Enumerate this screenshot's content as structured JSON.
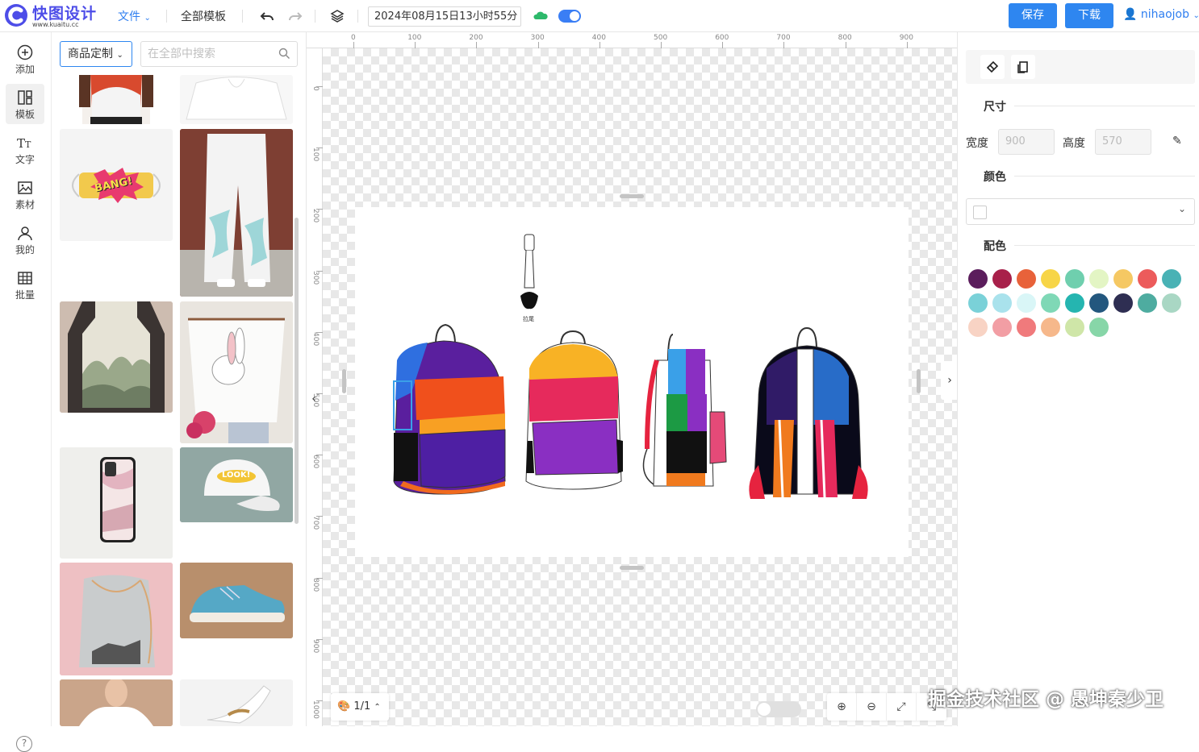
{
  "app": {
    "logo_name": "快图设计",
    "logo_url": "www.kuaitu.cc"
  },
  "toolbar": {
    "file_menu": "文件",
    "all_templates": "全部模板",
    "timestamp": "2024年08月15日13小时55分",
    "save_label": "保存",
    "download_label": "下载",
    "username": "nihaojob",
    "icons": [
      "undo-icon",
      "redo-icon",
      "layers-icon",
      "cloud-icon"
    ],
    "accent_color": "#2e86f0"
  },
  "leftnav": {
    "items": [
      {
        "label": "添加",
        "icon": "plus-circle-icon"
      },
      {
        "label": "模板",
        "icon": "template-icon"
      },
      {
        "label": "文字",
        "icon": "text-icon"
      },
      {
        "label": "素材",
        "icon": "image-icon"
      },
      {
        "label": "我的",
        "icon": "user-icon"
      },
      {
        "label": "批量",
        "icon": "grid-icon"
      }
    ],
    "help": "?"
  },
  "panel": {
    "category": "商品定制",
    "search_placeholder": "在全部中搜索",
    "thumbnails": [
      "t-shirt",
      "hoodie",
      "face-mask BANG!",
      "joggers",
      "apron-landscape",
      "apron-rabbit",
      "phone-case",
      "cap LOOK!",
      "drawstring-bag",
      "sneaker",
      "shirt",
      "high-heel"
    ],
    "mask_text": "BANG!",
    "cap_text": "LOOK!"
  },
  "canvas": {
    "ruler_x": [
      "0",
      "100",
      "200",
      "300",
      "400",
      "500",
      "600",
      "700",
      "800",
      "900"
    ],
    "ruler_y": [
      "0",
      "100",
      "200",
      "300",
      "400",
      "500",
      "600",
      "700",
      "800",
      "900",
      "1000"
    ],
    "zipper_label": "拉尾",
    "page_indicator": "1/1",
    "zoom_icons": [
      "zoom-in-icon",
      "zoom-out-icon",
      "fit-screen-icon",
      "collapse-icon"
    ]
  },
  "rightpanel": {
    "size_title": "尺寸",
    "width_label": "宽度",
    "width_value": "900",
    "height_label": "高度",
    "height_value": "570",
    "color_title": "颜色",
    "palette_title": "配色",
    "palette": [
      "#5b1d5c",
      "#a8204a",
      "#e8623a",
      "#f7d547",
      "#6fcfae",
      "#e3f5c4",
      "#f5c863",
      "#ec5b5b",
      "#49b2b5",
      "#7ad1d8",
      "#a9e2ec",
      "#d9f6f7",
      "#7fd8b6",
      "#25b5b0",
      "#23577e",
      "#2e2e52",
      "#4eaca0",
      "#a9d7c4",
      "#f8d3c4",
      "#f29ea4",
      "#f07a7c",
      "#f6b88b",
      "#cfe6a8",
      "#87d6a8"
    ]
  },
  "watermark": "掘金技术社区 @ 愚坤秦少卫"
}
